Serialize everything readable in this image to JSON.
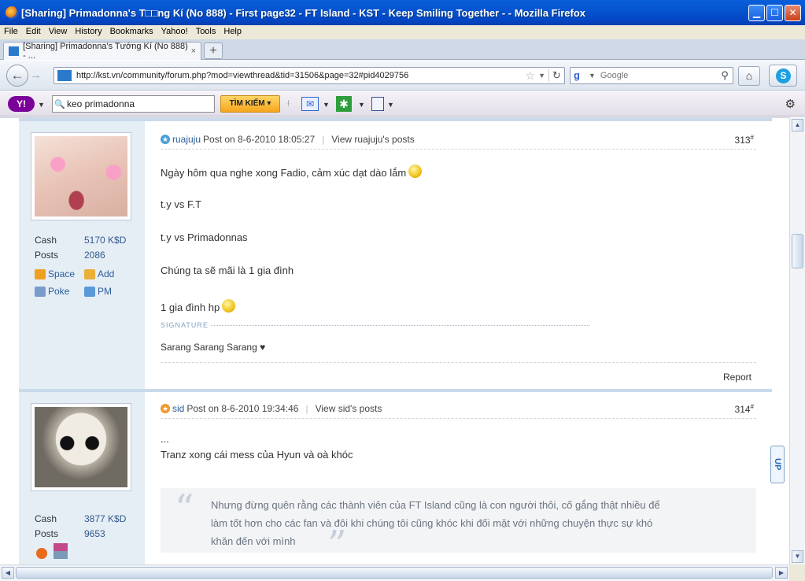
{
  "window": {
    "title": "[Sharing] Primadonna's T□□ng Kí (No 888) - First page32 - FT Island - KST - Keep Smiling Together - - Mozilla Firefox",
    "buttons": {
      "minimize": "▁",
      "maximize": "☐",
      "close": "✕"
    }
  },
  "menu": [
    "File",
    "Edit",
    "View",
    "History",
    "Bookmarks",
    "Yahoo!",
    "Tools",
    "Help"
  ],
  "tab": {
    "label": "[Sharing] Primadonna's Tướng Kí (No 888) - ...",
    "close": "×",
    "newtab": "+"
  },
  "nav": {
    "url": "http://kst.vn/community/forum.php?mod=viewthread&tid=31506&page=32#pid4029756",
    "search_placeholder": "Google"
  },
  "yahoo": {
    "logo": "Y!",
    "search_value": "keo primadonna",
    "search_button": "TÌM KIẾM ▾"
  },
  "posts": [
    {
      "stats": {
        "cash_label": "Cash",
        "cash_value": "5170 K$D",
        "posts_label": "Posts",
        "posts_value": "2086"
      },
      "links": {
        "space": "Space",
        "add": "Add",
        "poke": "Poke",
        "pm": "PM"
      },
      "username": "ruajuju",
      "posted": "Post on 8-6-2010 18:05:27",
      "view_posts": "View ruajuju's posts",
      "number": "313",
      "lines": [
        "Ngày hôm qua nghe xong Fadio, cảm xúc dạt dào lắm",
        "t.y vs F.T",
        "t.y vs Primadonnas",
        "Chúng ta sẽ mãi là 1 gia đình",
        "1 gia đình hp"
      ],
      "signature_label": "SIGNATURE",
      "signature": "Sarang Sarang Sarang ♥",
      "report": "Report"
    },
    {
      "stats": {
        "cash_label": "Cash",
        "cash_value": "3877 K$D",
        "posts_label": "Posts",
        "posts_value": "9653"
      },
      "username": "sid",
      "posted": "Post on 8-6-2010 19:34:46",
      "view_posts": "View sid's posts",
      "number": "314",
      "lines": [
        "...",
        "Tranz xong cái mess của Hyun và oà khóc"
      ],
      "quote": [
        "Nhưng đừng quên rằng các thành viên của FT Island cũng là con người thôi, cố gắng thật nhiều để",
        "làm tốt hơn cho các fan và đôi khi chúng tôi cũng khóc khi  đối mặt với những chuyện  thực sự khó",
        "khăn đến với mình"
      ]
    }
  ],
  "upbutton": "UP"
}
